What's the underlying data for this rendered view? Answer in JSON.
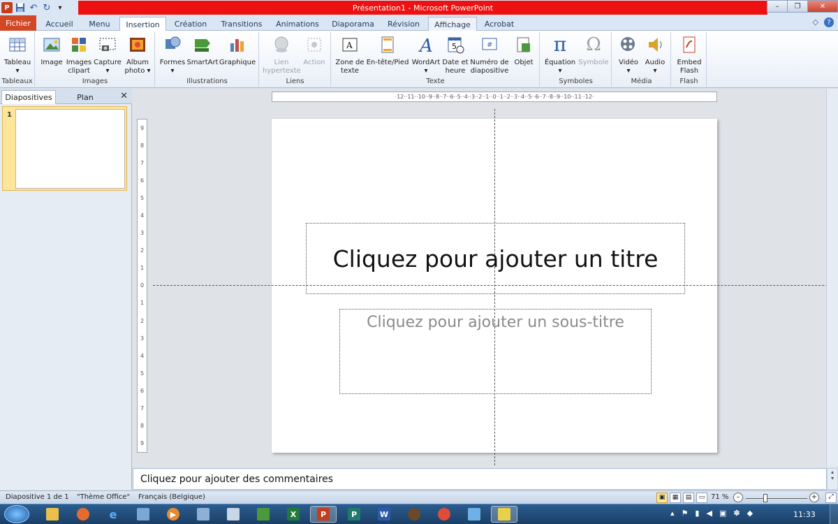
{
  "titlebar": {
    "title": "Présentation1  -  Microsoft PowerPoint",
    "app_icon": "P",
    "undo": "↶",
    "redo": "↻",
    "qat_more": "▾",
    "minimize": "–",
    "restore": "❐",
    "close": "✕"
  },
  "tabs": {
    "fichier": "Fichier",
    "items": [
      "Accueil",
      "Menu",
      "Insertion",
      "Création",
      "Transitions",
      "Animations",
      "Diaporama",
      "Révision",
      "Affichage",
      "Acrobat"
    ],
    "active": "Insertion",
    "help": "?",
    "collapse": "◇"
  },
  "ribbon": {
    "groups": [
      {
        "label": "Tableaux",
        "buttons": [
          "Tableau"
        ]
      },
      {
        "label": "Images",
        "buttons": [
          "Image",
          "Images clipart",
          "Capture",
          "Album photo"
        ]
      },
      {
        "label": "Illustrations",
        "buttons": [
          "Formes",
          "SmartArt",
          "Graphique"
        ]
      },
      {
        "label": "Liens",
        "buttons": [
          "Lien hypertexte",
          "Action"
        ]
      },
      {
        "label": "Texte",
        "buttons": [
          "Zone de texte",
          "En-tête/Pied",
          "WordArt",
          "Date et heure",
          "Numéro de diapositive",
          "Objet"
        ]
      },
      {
        "label": "Symboles",
        "buttons": [
          "Équation",
          "Symbole"
        ]
      },
      {
        "label": "Média",
        "buttons": [
          "Vidéo",
          "Audio"
        ]
      },
      {
        "label": "Flash",
        "buttons": [
          "Embed Flash"
        ]
      }
    ],
    "icon_glyphs": {
      "pi": "π",
      "omega": "Ω",
      "wordart": "A",
      "date": "5",
      "number": "#",
      "textbox": "A"
    },
    "colors": {
      "accent_file": "#d24726",
      "title_red": "#ee1111"
    }
  },
  "leftpanel": {
    "tab_slides": "Diapositives",
    "tab_outline": "Plan",
    "close": "✕",
    "slide_number": "1"
  },
  "rulers": {
    "horizontal": "·12··11··10··9··8··7··6··5··4··3··2··1··0··1··2··3··4··5··6··7··8··9··10··11··12·",
    "vertical": [
      "9",
      "8",
      "7",
      "6",
      "5",
      "4",
      "3",
      "2",
      "1",
      "0",
      "1",
      "2",
      "3",
      "4",
      "5",
      "6",
      "7",
      "8",
      "9"
    ]
  },
  "slide": {
    "title_placeholder": "Cliquez pour ajouter un titre",
    "subtitle_placeholder": "Cliquez pour ajouter un sous-titre"
  },
  "notes": {
    "placeholder": "Cliquez pour ajouter des commentaires"
  },
  "statusbar": {
    "slide_info": "Diapositive 1 de 1",
    "theme": "\"Thème Office\"",
    "language": "Français (Belgique)",
    "zoom": "71 %",
    "zoom_minus": "–",
    "zoom_plus": "+"
  },
  "taskbar": {
    "clock": "11:33",
    "apps": [
      "explorer",
      "firefox",
      "internet-explorer",
      "app4",
      "media-player",
      "app6",
      "notepad",
      "app8",
      "excel",
      "powerpoint",
      "publisher",
      "word",
      "app13",
      "chrome",
      "app15",
      "app16"
    ]
  }
}
